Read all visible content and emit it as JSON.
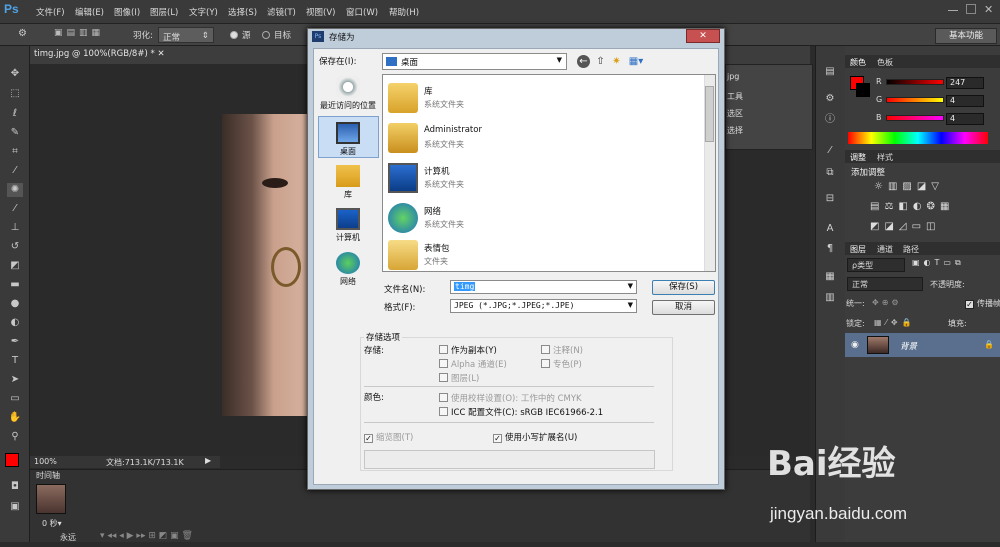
{
  "app": {
    "logo": "Ps"
  },
  "menu": [
    "文件(F)",
    "编辑(E)",
    "图像(I)",
    "图层(L)",
    "文字(Y)",
    "选择(S)",
    "滤镜(T)",
    "视图(V)",
    "窗口(W)",
    "帮助(H)"
  ],
  "options": {
    "feather_label": "羽化:",
    "mode_value": "正常",
    "radio1": "源",
    "radio2": "目标",
    "workspace": "基本功能"
  },
  "document": {
    "tab": "timg.jpg @ 100%(RGB/8#) *",
    "zoom": "100%",
    "doc_info": "文档:713.1K/713.1K"
  },
  "timeline": {
    "label": "时间轴",
    "frame_time": "0 秒▾",
    "loop": "永远"
  },
  "collapsed_panels": {
    "items": [
      "jpg",
      "工具",
      "选区",
      "选择"
    ]
  },
  "color_panel": {
    "tabs": [
      "颜色",
      "色板"
    ],
    "r_label": "R",
    "g_label": "G",
    "b_label": "B",
    "r": "247",
    "g": "4",
    "b": "4",
    "fg_color": "#ff0000",
    "bg_color": "#000000"
  },
  "adjust_panel": {
    "tabs": [
      "调整",
      "样式"
    ],
    "title": "添加调整"
  },
  "layers_panel": {
    "tabs": [
      "图层",
      "通道",
      "路径"
    ],
    "kind": "ρ类型",
    "blend": "正常",
    "opacity_label": "不透明度:",
    "unify_label": "统一:",
    "propagate_label": "传播帧",
    "lock_label": "锁定:",
    "fill_label": "填充:",
    "layer_name": "背景"
  },
  "dialog": {
    "title": "存储为",
    "save_in_label": "保存在(I):",
    "save_in_value": "桌面",
    "places": [
      "最近访问的位置",
      "桌面",
      "库",
      "计算机",
      "网络"
    ],
    "files": [
      {
        "name": "库",
        "type": "系统文件夹"
      },
      {
        "name": "Administrator",
        "type": "系统文件夹"
      },
      {
        "name": "计算机",
        "type": "系统文件夹"
      },
      {
        "name": "网络",
        "type": "系统文件夹"
      },
      {
        "name": "表情包",
        "type": "文件夹"
      }
    ],
    "filename_label": "文件名(N):",
    "filename_value": "timg",
    "format_label": "格式(F):",
    "format_value": "JPEG (*.JPG;*.JPEG;*.JPE)",
    "save_button": "保存(S)",
    "cancel_button": "取消",
    "save_options_title": "存储选项",
    "storage_label": "存储:",
    "as_copy": "作为副本(Y)",
    "notes": "注释(N)",
    "alpha": "Alpha 通道(E)",
    "spot": "专色(P)",
    "layers": "图层(L)",
    "color_label": "颜色:",
    "proof": "使用校样设置(O):",
    "proof_value": "工作中的 CMYK",
    "icc": "ICC 配置文件(C):",
    "icc_value": "sRGB IEC61966-2.1",
    "thumbnail": "缩览图(T)",
    "lowercase_ext": "使用小写扩展名(U)"
  },
  "watermark": {
    "brand": "Bai经验",
    "url": "jingyan.baidu.com"
  }
}
